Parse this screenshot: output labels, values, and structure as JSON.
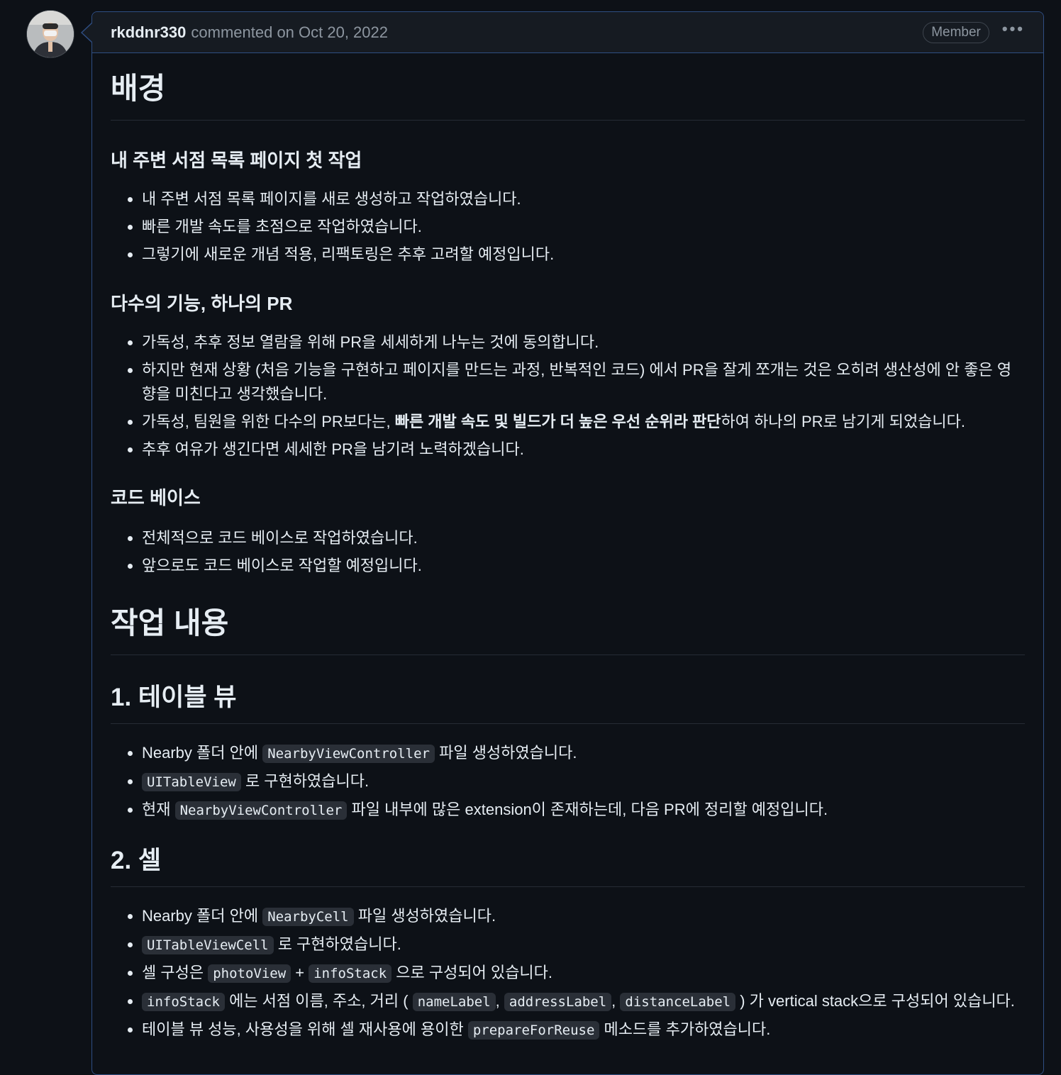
{
  "comment": {
    "author": "rkddnr330",
    "meta": "commented on Oct 20, 2022",
    "badge": "Member",
    "menu_icon": "kebab-horizontal-icon"
  },
  "sections": {
    "h_background": "배경",
    "h_page": "내 주변 서점 목록 페이지 첫 작업",
    "page_items": [
      "내 주변 서점 목록 페이지를 새로 생성하고 작업하였습니다.",
      "빠른 개발 속도를 초점으로 작업하였습니다.",
      "그렇기에 새로운 개념 적용, 리팩토링은 추후 고려할 예정입니다."
    ],
    "h_pr": "다수의 기능, 하나의 PR",
    "pr_items": [
      "가독성, 추후 정보 열람을 위해 PR을 세세하게 나누는 것에 동의합니다.",
      "하지만 현재 상황 (처음 기능을 구현하고 페이지를 만드는 과정, 반복적인 코드) 에서 PR을 잘게 쪼개는 것은 오히려 생산성에 안 좋은 영향을 미친다고 생각했습니다."
    ],
    "pr_item3_before": "가독성, 팀원을 위한 다수의 PR보다는, ",
    "pr_item3_bold": "빠른 개발 속도 및 빌드가 더 높은 우선 순위라 판단",
    "pr_item3_after": "하여 하나의 PR로 남기게 되었습니다.",
    "pr_item4": "추후 여유가 생긴다면 세세한 PR을 남기려 노력하겠습니다.",
    "h_codebase": "코드 베이스",
    "codebase_items": [
      "전체적으로 코드 베이스로 작업하였습니다.",
      "앞으로도 코드 베이스로 작업할 예정입니다."
    ],
    "h_work": "작업 내용",
    "h_table": "1. 테이블 뷰",
    "table": {
      "i1_a": "Nearby 폴더 안에 ",
      "i1_code": "NearbyViewController",
      "i1_b": " 파일 생성하였습니다.",
      "i2_code": "UITableView",
      "i2_b": " 로 구현하였습니다.",
      "i3_a": "현재 ",
      "i3_code": "NearbyViewController",
      "i3_b": " 파일 내부에 많은 extension이 존재하는데, 다음 PR에 정리할 예정입니다."
    },
    "h_cell": "2. 셀",
    "cell": {
      "i1_a": "Nearby 폴더 안에 ",
      "i1_code": "NearbyCell",
      "i1_b": " 파일 생성하였습니다.",
      "i2_code": "UITableViewCell",
      "i2_b": " 로 구현하였습니다.",
      "i3_a": "셀 구성은 ",
      "i3_code1": "photoView",
      "i3_plus": " + ",
      "i3_code2": "infoStack",
      "i3_b": " 으로 구성되어 있습니다.",
      "i4_code": "infoStack",
      "i4_a": " 에는 서점 이름, 주소, 거리 ( ",
      "i4_code1": "nameLabel",
      "i4_sep1": ", ",
      "i4_code2": "addressLabel",
      "i4_sep2": ", ",
      "i4_code3": "distanceLabel",
      "i4_b": " ) 가 vertical stack으로 구성되어 있습니다.",
      "i5_a": "테이블 뷰 성능, 사용성을 위해 셀 재사용에 용이한 ",
      "i5_code": "prepareForReuse",
      "i5_b": " 메소드를 추가하였습니다."
    }
  }
}
